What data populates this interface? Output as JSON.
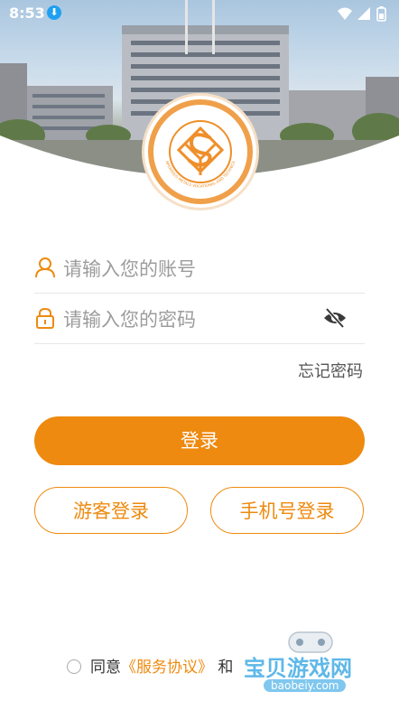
{
  "status_bar": {
    "time": "8:53"
  },
  "logo": {
    "ring_text_cn": "湖南有色金属职业技术学院",
    "ring_text_en": "HUNAN NONFERROUS METALS VOCATIONAL AND TECHNICAL COLLEGE"
  },
  "login_form": {
    "account_placeholder": "请输入您的账号",
    "password_placeholder": "请输入您的密码",
    "forgot_password": "忘记密码",
    "login_button": "登录",
    "guest_login_button": "游客登录",
    "phone_login_button": "手机号登录"
  },
  "agreement": {
    "prefix": "同意",
    "service_agreement": "《服务协议》",
    "conjunction": "和"
  },
  "watermark": {
    "title": "宝贝游戏网",
    "url": "baobeiy.com"
  },
  "colors": {
    "accent": "#ee8a0f",
    "placeholder": "#9c9c9c"
  },
  "icons": [
    "download-icon",
    "wifi-icon",
    "signal-icon",
    "battery-icon",
    "user-icon",
    "lock-icon",
    "eye-off-icon"
  ]
}
